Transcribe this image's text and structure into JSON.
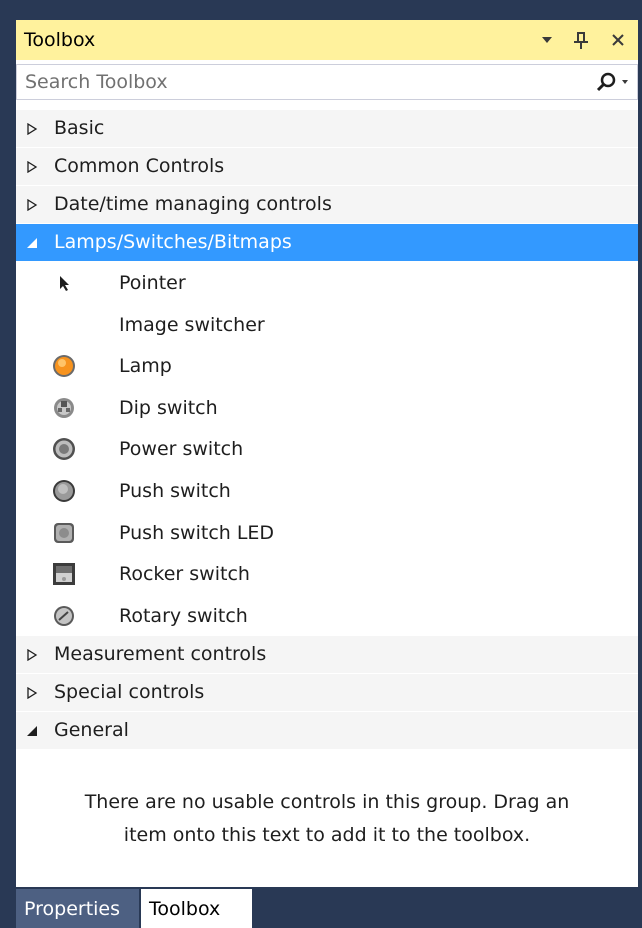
{
  "panel": {
    "title": "Toolbox",
    "buttons": {
      "dropdown_icon": "dropdown-arrow",
      "pin_icon": "pin",
      "close_icon": "close"
    }
  },
  "search": {
    "placeholder": "Search Toolbox",
    "icon": "search"
  },
  "groups": {
    "basic": {
      "label": "Basic",
      "expanded": false
    },
    "common": {
      "label": "Common Controls",
      "expanded": false
    },
    "datetime": {
      "label": "Date/time managing controls",
      "expanded": false
    },
    "lamps": {
      "label": "Lamps/Switches/Bitmaps",
      "expanded": true,
      "selected": true,
      "items": [
        {
          "label": "Pointer",
          "icon": "pointer-arrow"
        },
        {
          "label": "Image switcher",
          "icon": ""
        },
        {
          "label": "Lamp",
          "icon": "orange-lamp"
        },
        {
          "label": "Dip switch",
          "icon": "dip-switch"
        },
        {
          "label": "Power switch",
          "icon": "power-switch"
        },
        {
          "label": "Push switch",
          "icon": "push-switch"
        },
        {
          "label": "Push switch LED",
          "icon": "push-switch-led"
        },
        {
          "label": "Rocker switch",
          "icon": "rocker-switch"
        },
        {
          "label": "Rotary switch",
          "icon": "rotary-switch"
        }
      ]
    },
    "measurement": {
      "label": "Measurement controls",
      "expanded": false
    },
    "special": {
      "label": "Special controls",
      "expanded": false
    },
    "general": {
      "label": "General",
      "expanded": true,
      "empty_message_line1": "There are no usable controls in this group. Drag an",
      "empty_message_line2": "item onto this text to add it to the toolbox."
    }
  },
  "bottom_tabs": [
    {
      "label": "Properties",
      "active": false
    },
    {
      "label": "Toolbox",
      "active": true
    }
  ],
  "colors": {
    "frame": "#293955",
    "titlebar": "#fff29d",
    "selection": "#3399ff",
    "group_header": "#f5f5f5",
    "lamp": "#f7931e"
  }
}
